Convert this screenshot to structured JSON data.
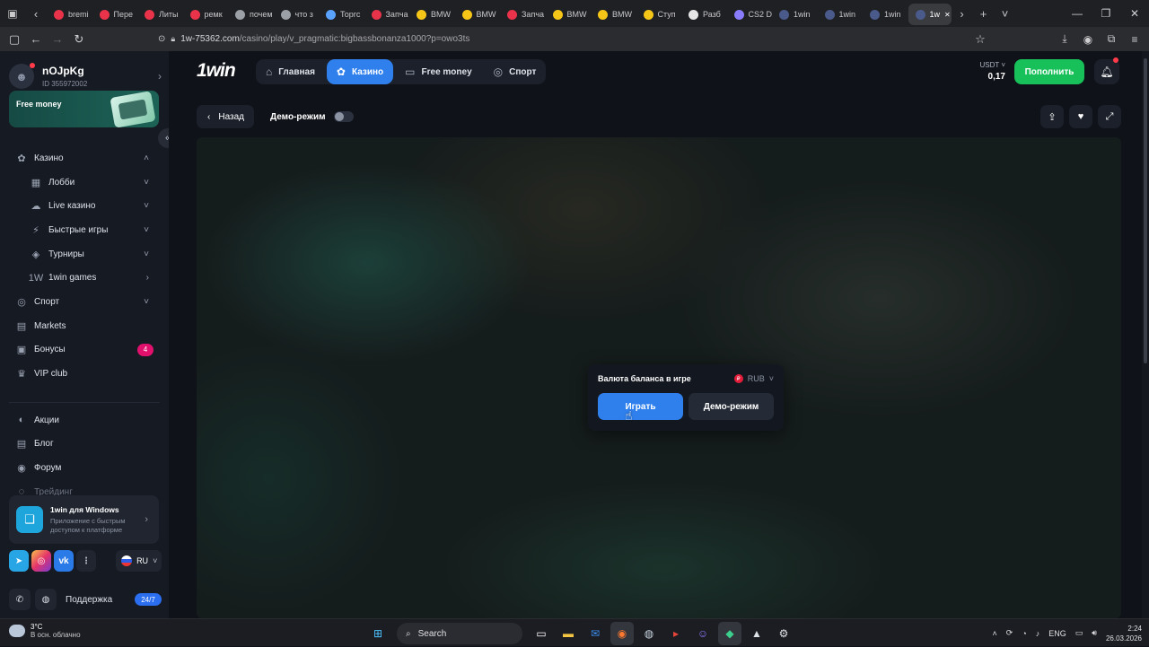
{
  "browser": {
    "tabs": [
      {
        "label": "bremi",
        "color": "#e8334a"
      },
      {
        "label": "Пере",
        "color": "#e8334a"
      },
      {
        "label": "Литы",
        "color": "#e8334a"
      },
      {
        "label": "ремк",
        "color": "#e8334a"
      },
      {
        "label": "почем",
        "color": "#9aa0a6"
      },
      {
        "label": "что з",
        "color": "#9aa0a6"
      },
      {
        "label": "Торгс",
        "color": "#5aa2ff"
      },
      {
        "label": "Запча",
        "color": "#e8334a"
      },
      {
        "label": "BMW",
        "color": "#f5c518"
      },
      {
        "label": "BMW",
        "color": "#f5c518"
      },
      {
        "label": "Запча",
        "color": "#e8334a"
      },
      {
        "label": "BMW",
        "color": "#f5c518"
      },
      {
        "label": "BMW",
        "color": "#f5c518"
      },
      {
        "label": "Ступ",
        "color": "#f5c518"
      },
      {
        "label": "Разб",
        "color": "#e6e6e6"
      },
      {
        "label": "CS2 D",
        "color": "#8a7cff"
      },
      {
        "label": "1win",
        "color": "#4a5a8a"
      },
      {
        "label": "1win",
        "color": "#4a5a8a"
      },
      {
        "label": "1win",
        "color": "#4a5a8a"
      },
      {
        "label": "1w",
        "color": "#4a5a8a"
      }
    ],
    "url_host": "1w-75362.com",
    "url_path": "/casino/play/v_pragmatic:bigbassbonanza1000?p=owo3ts"
  },
  "sidebar": {
    "username": "nOJpKg",
    "user_id": "ID 355972002",
    "free_money_banner": "Free money",
    "menu": [
      {
        "label": "Казино",
        "icon": "casino-icon",
        "glyph": "✿",
        "sub": false,
        "chevron": "˄"
      },
      {
        "label": "Лобби",
        "icon": "lobby-icon",
        "glyph": "▦",
        "sub": true,
        "chevron": "˅"
      },
      {
        "label": "Live казино",
        "icon": "live-casino-icon",
        "glyph": "☁",
        "sub": true,
        "chevron": "˅"
      },
      {
        "label": "Быстрые игры",
        "icon": "quick-games-icon",
        "glyph": "⚡",
        "sub": true,
        "chevron": "˅"
      },
      {
        "label": "Турниры",
        "icon": "tournaments-icon",
        "glyph": "◈",
        "sub": true,
        "chevron": "˅"
      },
      {
        "label": "1win games",
        "icon": "1win-games-icon",
        "glyph": "1W",
        "sub": true,
        "chevron": "›"
      },
      {
        "label": "Спорт",
        "icon": "sport-icon",
        "glyph": "◎",
        "sub": false,
        "chevron": "˅"
      },
      {
        "label": "Markets",
        "icon": "markets-icon",
        "glyph": "▤",
        "sub": false,
        "chevron": ""
      },
      {
        "label": "Бонусы",
        "icon": "bonus-icon",
        "glyph": "▣",
        "sub": false,
        "badge": "4"
      },
      {
        "label": "VIP club",
        "icon": "vip-icon",
        "glyph": "♛",
        "sub": false,
        "chevron": ""
      }
    ],
    "menu2": [
      {
        "label": "Акции",
        "icon": "promo-icon",
        "glyph": "◐"
      },
      {
        "label": "Блог",
        "icon": "blog-icon",
        "glyph": "▤"
      },
      {
        "label": "Форум",
        "icon": "forum-icon",
        "glyph": "◉"
      },
      {
        "label": "Трейдинг",
        "icon": "trading-icon",
        "glyph": "◌"
      }
    ],
    "app_card": {
      "title": "1win для Windows",
      "desc": "Приложение с быстрым доступом к платформе"
    },
    "language": "RU",
    "support_label": "Поддержка",
    "support_badge": "24/7"
  },
  "topnav": {
    "brand": "1win",
    "items": [
      {
        "label": "Главная",
        "icon": "home-icon",
        "glyph": "⌂",
        "active": false
      },
      {
        "label": "Казино",
        "icon": "casino-icon",
        "glyph": "✿",
        "active": true
      },
      {
        "label": "Free money",
        "icon": "free-money-icon",
        "glyph": "▭",
        "active": false
      },
      {
        "label": "Спорт",
        "icon": "sport-icon",
        "glyph": "◎",
        "active": false
      }
    ],
    "currency": "USDT",
    "balance": "0,17",
    "deposit_label": "Пополнить"
  },
  "game": {
    "back_label": "Назад",
    "demo_mode_label": "Демо-режим",
    "dialog_title": "Валюта баланса в игре",
    "dialog_currency": "RUB",
    "play_label": "Играть",
    "demo_label": "Демо-режим"
  },
  "taskbar": {
    "weather_temp": "3°C",
    "weather_desc": "В осн. облачно",
    "search_label": "Search",
    "lang": "ENG",
    "time": "2:24",
    "date": "26.03.2026"
  }
}
